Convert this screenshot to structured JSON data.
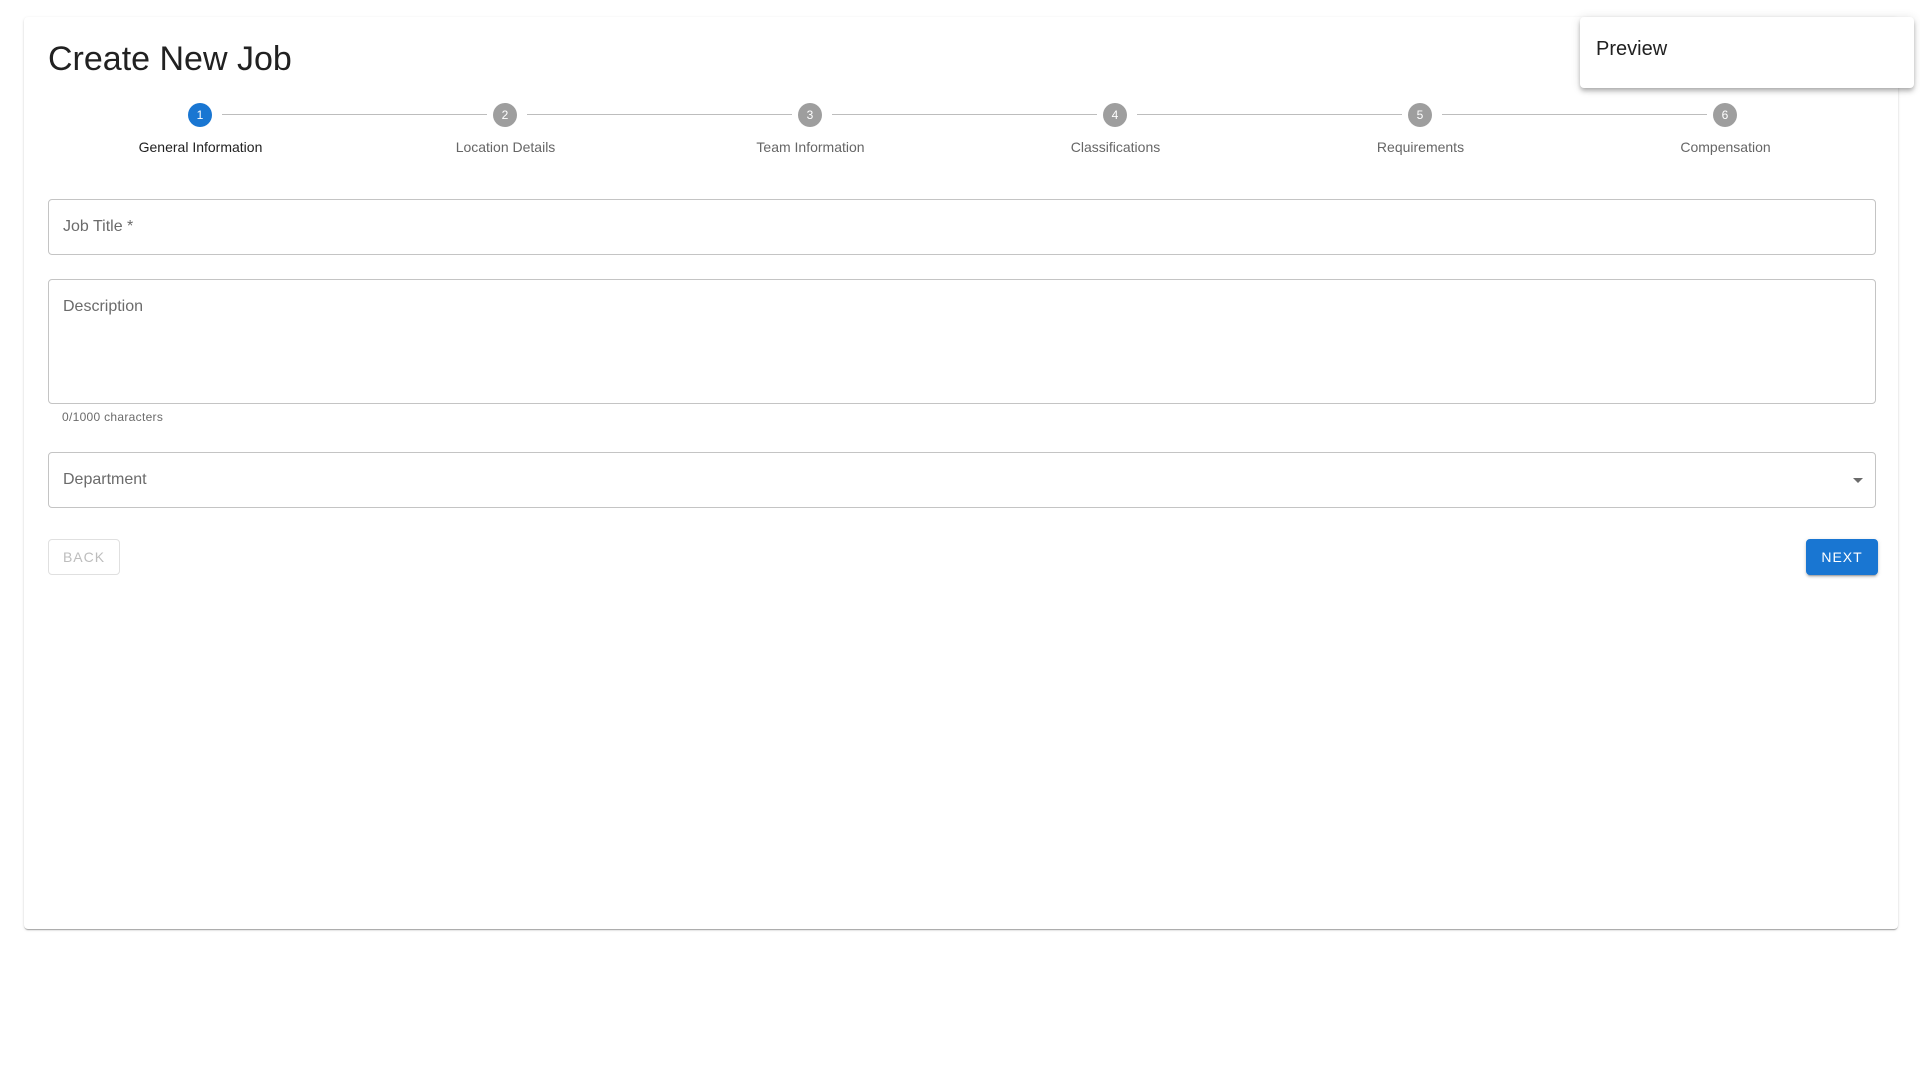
{
  "page": {
    "title": "Create New Job"
  },
  "preview": {
    "title": "Preview"
  },
  "stepper": {
    "steps": [
      {
        "number": "1",
        "label": "General Information",
        "active": true
      },
      {
        "number": "2",
        "label": "Location Details",
        "active": false
      },
      {
        "number": "3",
        "label": "Team Information",
        "active": false
      },
      {
        "number": "4",
        "label": "Classifications",
        "active": false
      },
      {
        "number": "5",
        "label": "Requirements",
        "active": false
      },
      {
        "number": "6",
        "label": "Compensation",
        "active": false
      }
    ]
  },
  "form": {
    "job_title": {
      "label": "Job Title *",
      "value": ""
    },
    "description": {
      "label": "Description",
      "value": "",
      "helper": "0/1000 characters"
    },
    "department": {
      "label": "Department",
      "value": ""
    }
  },
  "actions": {
    "back_label": "BACK",
    "next_label": "NEXT"
  },
  "colors": {
    "primary": "#1976d2",
    "inactive_step": "#9e9e9e",
    "border": "#c4c4c4"
  }
}
